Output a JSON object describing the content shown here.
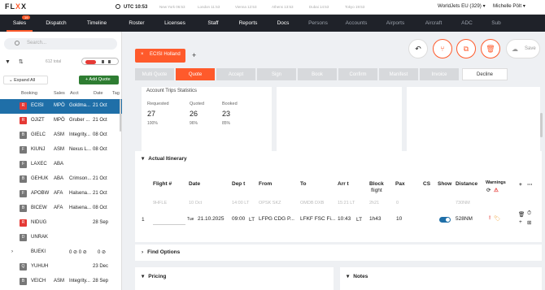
{
  "header": {
    "logo_prefix": "FL",
    "logo_x": "X",
    "logo_suffix": "X",
    "clock": "UTC 10:53",
    "timezones": [
      "New York 06:53",
      "London 11:53",
      "Vienna 12:53",
      "Athens 13:53",
      "Dubai 14:53",
      "Tokyo 19:53"
    ],
    "mode_select": "WorldJets EU (329)",
    "user": "Michelle Pölt"
  },
  "nav": {
    "sales": "Sales",
    "sales_badge": "19",
    "dispatch": "Dispatch",
    "timeline": "Timeline",
    "roster": "Roster",
    "licenses": "Licenses",
    "staff": "Staff",
    "reports": "Reports",
    "docs": "Docs",
    "persons": "Persons",
    "accounts": "Accounts",
    "airports": "Airports",
    "aircraft": "Aircraft",
    "adc": "ADC",
    "sub": "Sub"
  },
  "left": {
    "search_placeholder": "Search...",
    "total": "612 total",
    "expand_all": "Expand All",
    "add_quote": "+ Add Quote",
    "columns": [
      "Booking",
      "Sales",
      "Acct",
      "Date",
      "Tag"
    ],
    "rows": [
      {
        "status": "R",
        "booking": "ECISI",
        "sales": "MPÖ",
        "acct": "Goldma...",
        "date": "21 Oct",
        "icons": ""
      },
      {
        "status": "R",
        "booking": "OJIZT",
        "sales": "MPÖ",
        "acct": "Gruber ...",
        "date": "21 Oct",
        "icons": ""
      },
      {
        "status": "B",
        "booking": "GIELC",
        "sales": "ASM",
        "acct": "Integrity...",
        "date": "08 Oct",
        "icons": ""
      },
      {
        "status": "F",
        "booking": "KIUNJ",
        "sales": "ASM",
        "acct": "Nexus L...",
        "date": "08 Oct",
        "icons": ""
      },
      {
        "status": "F",
        "booking": "LAXEC",
        "sales": "ABA",
        "acct": "",
        "date": "",
        "icons": ""
      },
      {
        "status": "B",
        "booking": "GEHUK",
        "sales": "ABA",
        "acct": "Crimson...",
        "date": "21 Oct",
        "icons": ""
      },
      {
        "status": "F",
        "booking": "APOBW",
        "sales": "AFA",
        "acct": "Halsena...",
        "date": "21 Oct",
        "icons": ""
      },
      {
        "status": "B",
        "booking": "BICEW",
        "sales": "AFA",
        "acct": "Halsena...",
        "date": "08 Oct",
        "icons": ""
      },
      {
        "status": "R",
        "booking": "NIDUG",
        "sales": "",
        "acct": "",
        "date": "28 Sep",
        "icons": ""
      },
      {
        "status": "D",
        "booking": "UNRAK",
        "sales": "",
        "acct": "",
        "date": "",
        "icons": ""
      },
      {
        "status": "",
        "booking": "BUEKI",
        "sales": "",
        "acct": "0 ⊘  0 ⊘",
        "date": "0 ⊘",
        "icons": ""
      },
      {
        "status": "Q",
        "booking": "YUHUH",
        "sales": "",
        "acct": "",
        "date": "23 Dec",
        "icons": ""
      },
      {
        "status": "B",
        "booking": "VEICH",
        "sales": "ASM",
        "acct": "Integrity...",
        "date": "28 Sep",
        "icons": ""
      }
    ]
  },
  "main": {
    "tab_label": "ECISI Holland",
    "add_tab": "+",
    "save_label": "Save",
    "steps": [
      "Multi Quote",
      "Quote",
      "Accept",
      "Sign",
      "Book",
      "Confirm",
      "Manifest",
      "Invoice"
    ],
    "active_step": "Quote",
    "decline": "Decline",
    "stats": {
      "title": "Account Trips Statistics",
      "requested_label": "Requested",
      "requested": "27",
      "requested_pct": "100%",
      "quoted_label": "Quoted",
      "quoted": "26",
      "quoted_pct": "96%",
      "booked_label": "Booked",
      "booked": "23",
      "booked_pct": "85%"
    },
    "itinerary_title": "Actual Itinerary",
    "itinerary_headers": {
      "flight": "Flight #",
      "date": "Date",
      "dep": "Dep t",
      "from": "From",
      "to": "To",
      "arr": "Arr t",
      "block": "Block",
      "block_sub": "flight",
      "pax": "Pax",
      "cs": "CS",
      "show": "Show",
      "distance": "Distance",
      "warnings": "Warnings"
    },
    "ghost_row": {
      "flight": "9HFLE",
      "date": "10 Oct",
      "dep": "14:00 LT",
      "from": "OPSK SKZ",
      "to": "OMDB DXB",
      "arr": "15:21 LT",
      "block": "2h21",
      "pax": "0",
      "distance": "730NM"
    },
    "leg": {
      "index": "1",
      "dow": "Tue",
      "date": "21.10.2025",
      "dep": "09:00",
      "dep_tz": "LT",
      "from": "LFPG CDG P...",
      "to": "LFKF FSC Fi...",
      "arr": "10:43",
      "arr_tz": "LT",
      "block": "1h43",
      "pax": "10",
      "distance": "528NM"
    },
    "find_options": "Find Options",
    "pricing": "Pricing",
    "notes": "Notes"
  },
  "colors": {
    "accent": "#ff5a2b",
    "nav_bg": "#1f2229",
    "selected_row": "#1f6fa8",
    "add_quote": "#2e7d32"
  }
}
